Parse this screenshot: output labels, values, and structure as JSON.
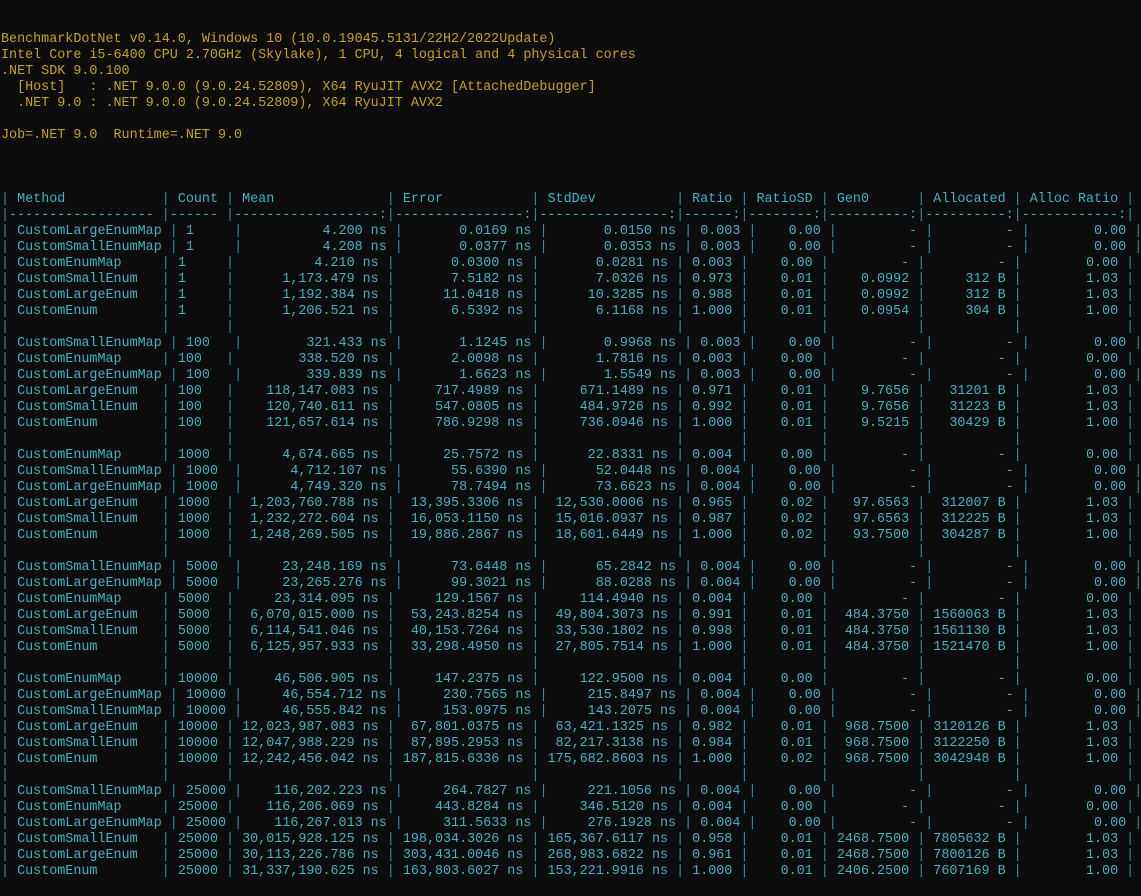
{
  "header_lines": [
    "BenchmarkDotNet v0.14.0, Windows 10 (10.0.19045.5131/22H2/2022Update)",
    "Intel Core i5-6400 CPU 2.70GHz (Skylake), 1 CPU, 4 logical and 4 physical cores",
    ".NET SDK 9.0.100",
    "  [Host]   : .NET 9.0.0 (9.0.24.52809), X64 RyuJIT AVX2 [AttachedDebugger]",
    "  .NET 9.0 : .NET 9.0.0 (9.0.24.52809), X64 RyuJIT AVX2",
    "",
    "Job=.NET 9.0  Runtime=.NET 9.0",
    ""
  ],
  "table": {
    "columns": [
      {
        "name": "Method",
        "width": 19,
        "align": "left"
      },
      {
        "name": "Count",
        "width": 7,
        "align": "left"
      },
      {
        "name": "Mean",
        "width": 19,
        "align": "right"
      },
      {
        "name": "Error",
        "width": 17,
        "align": "right"
      },
      {
        "name": "StdDev",
        "width": 17,
        "align": "right"
      },
      {
        "name": "Ratio",
        "width": 7,
        "align": "right"
      },
      {
        "name": "RatioSD",
        "width": 9,
        "align": "right"
      },
      {
        "name": "Gen0",
        "width": 11,
        "align": "right"
      },
      {
        "name": "Allocated",
        "width": 11,
        "align": "right"
      },
      {
        "name": "Alloc Ratio",
        "width": 13,
        "align": "right"
      }
    ],
    "groups": [
      [
        [
          "CustomLargeEnumMap",
          "1",
          "4.200 ns",
          "0.0169 ns",
          "0.0150 ns",
          "0.003",
          "0.00",
          "-",
          "-",
          "0.00"
        ],
        [
          "CustomSmallEnumMap",
          "1",
          "4.208 ns",
          "0.0377 ns",
          "0.0353 ns",
          "0.003",
          "0.00",
          "-",
          "-",
          "0.00"
        ],
        [
          "CustomEnumMap",
          "1",
          "4.210 ns",
          "0.0300 ns",
          "0.0281 ns",
          "0.003",
          "0.00",
          "-",
          "-",
          "0.00"
        ],
        [
          "CustomSmallEnum",
          "1",
          "1,173.479 ns",
          "7.5182 ns",
          "7.0326 ns",
          "0.973",
          "0.01",
          "0.0992",
          "312 B",
          "1.03"
        ],
        [
          "CustomLargeEnum",
          "1",
          "1,192.384 ns",
          "11.0418 ns",
          "10.3285 ns",
          "0.988",
          "0.01",
          "0.0992",
          "312 B",
          "1.03"
        ],
        [
          "CustomEnum",
          "1",
          "1,206.521 ns",
          "6.5392 ns",
          "6.1168 ns",
          "1.000",
          "0.01",
          "0.0954",
          "304 B",
          "1.00"
        ]
      ],
      [
        [
          "CustomSmallEnumMap",
          "100",
          "321.433 ns",
          "1.1245 ns",
          "0.9968 ns",
          "0.003",
          "0.00",
          "-",
          "-",
          "0.00"
        ],
        [
          "CustomEnumMap",
          "100",
          "338.520 ns",
          "2.0098 ns",
          "1.7816 ns",
          "0.003",
          "0.00",
          "-",
          "-",
          "0.00"
        ],
        [
          "CustomLargeEnumMap",
          "100",
          "339.839 ns",
          "1.6623 ns",
          "1.5549 ns",
          "0.003",
          "0.00",
          "-",
          "-",
          "0.00"
        ],
        [
          "CustomLargeEnum",
          "100",
          "118,147.083 ns",
          "717.4989 ns",
          "671.1489 ns",
          "0.971",
          "0.01",
          "9.7656",
          "31201 B",
          "1.03"
        ],
        [
          "CustomSmallEnum",
          "100",
          "120,740.611 ns",
          "547.0805 ns",
          "484.9726 ns",
          "0.992",
          "0.01",
          "9.7656",
          "31223 B",
          "1.03"
        ],
        [
          "CustomEnum",
          "100",
          "121,657.614 ns",
          "786.9298 ns",
          "736.0946 ns",
          "1.000",
          "0.01",
          "9.5215",
          "30429 B",
          "1.00"
        ]
      ],
      [
        [
          "CustomEnumMap",
          "1000",
          "4,674.665 ns",
          "25.7572 ns",
          "22.8331 ns",
          "0.004",
          "0.00",
          "-",
          "-",
          "0.00"
        ],
        [
          "CustomSmallEnumMap",
          "1000",
          "4,712.107 ns",
          "55.6390 ns",
          "52.0448 ns",
          "0.004",
          "0.00",
          "-",
          "-",
          "0.00"
        ],
        [
          "CustomLargeEnumMap",
          "1000",
          "4,749.320 ns",
          "78.7494 ns",
          "73.6623 ns",
          "0.004",
          "0.00",
          "-",
          "-",
          "0.00"
        ],
        [
          "CustomLargeEnum",
          "1000",
          "1,203,760.788 ns",
          "13,395.3306 ns",
          "12,530.0006 ns",
          "0.965",
          "0.02",
          "97.6563",
          "312007 B",
          "1.03"
        ],
        [
          "CustomSmallEnum",
          "1000",
          "1,232,272.604 ns",
          "16,053.1150 ns",
          "15,016.0937 ns",
          "0.987",
          "0.02",
          "97.6563",
          "312225 B",
          "1.03"
        ],
        [
          "CustomEnum",
          "1000",
          "1,248,269.505 ns",
          "19,886.2867 ns",
          "18,601.6449 ns",
          "1.000",
          "0.02",
          "93.7500",
          "304287 B",
          "1.00"
        ]
      ],
      [
        [
          "CustomSmallEnumMap",
          "5000",
          "23,248.169 ns",
          "73.6448 ns",
          "65.2842 ns",
          "0.004",
          "0.00",
          "-",
          "-",
          "0.00"
        ],
        [
          "CustomLargeEnumMap",
          "5000",
          "23,265.276 ns",
          "99.3021 ns",
          "88.0288 ns",
          "0.004",
          "0.00",
          "-",
          "-",
          "0.00"
        ],
        [
          "CustomEnumMap",
          "5000",
          "23,314.095 ns",
          "129.1567 ns",
          "114.4940 ns",
          "0.004",
          "0.00",
          "-",
          "-",
          "0.00"
        ],
        [
          "CustomLargeEnum",
          "5000",
          "6,070,015.000 ns",
          "53,243.8254 ns",
          "49,804.3073 ns",
          "0.991",
          "0.01",
          "484.3750",
          "1560063 B",
          "1.03"
        ],
        [
          "CustomSmallEnum",
          "5000",
          "6,114,541.046 ns",
          "40,153.7264 ns",
          "33,530.1802 ns",
          "0.998",
          "0.01",
          "484.3750",
          "1561130 B",
          "1.03"
        ],
        [
          "CustomEnum",
          "5000",
          "6,125,957.933 ns",
          "33,298.4950 ns",
          "27,805.7514 ns",
          "1.000",
          "0.01",
          "484.3750",
          "1521470 B",
          "1.00"
        ]
      ],
      [
        [
          "CustomEnumMap",
          "10000",
          "46,506.905 ns",
          "147.2375 ns",
          "122.9500 ns",
          "0.004",
          "0.00",
          "-",
          "-",
          "0.00"
        ],
        [
          "CustomLargeEnumMap",
          "10000",
          "46,554.712 ns",
          "230.7565 ns",
          "215.8497 ns",
          "0.004",
          "0.00",
          "-",
          "-",
          "0.00"
        ],
        [
          "CustomSmallEnumMap",
          "10000",
          "46,555.842 ns",
          "153.0975 ns",
          "143.2075 ns",
          "0.004",
          "0.00",
          "-",
          "-",
          "0.00"
        ],
        [
          "CustomLargeEnum",
          "10000",
          "12,023,987.083 ns",
          "67,801.0375 ns",
          "63,421.1325 ns",
          "0.982",
          "0.01",
          "968.7500",
          "3120126 B",
          "1.03"
        ],
        [
          "CustomSmallEnum",
          "10000",
          "12,047,988.229 ns",
          "87,895.2953 ns",
          "82,217.3138 ns",
          "0.984",
          "0.01",
          "968.7500",
          "3122250 B",
          "1.03"
        ],
        [
          "CustomEnum",
          "10000",
          "12,242,456.042 ns",
          "187,815.6336 ns",
          "175,682.8603 ns",
          "1.000",
          "0.02",
          "968.7500",
          "3042948 B",
          "1.00"
        ]
      ],
      [
        [
          "CustomSmallEnumMap",
          "25000",
          "116,202.223 ns",
          "264.7827 ns",
          "221.1056 ns",
          "0.004",
          "0.00",
          "-",
          "-",
          "0.00"
        ],
        [
          "CustomEnumMap",
          "25000",
          "116,206.069 ns",
          "443.8284 ns",
          "346.5120 ns",
          "0.004",
          "0.00",
          "-",
          "-",
          "0.00"
        ],
        [
          "CustomLargeEnumMap",
          "25000",
          "116,267.013 ns",
          "311.5633 ns",
          "276.1928 ns",
          "0.004",
          "0.00",
          "-",
          "-",
          "0.00"
        ],
        [
          "CustomSmallEnum",
          "25000",
          "30,015,928.125 ns",
          "198,034.3026 ns",
          "165,367.6117 ns",
          "0.958",
          "0.01",
          "2468.7500",
          "7805632 B",
          "1.03"
        ],
        [
          "CustomLargeEnum",
          "25000",
          "30,113,226.786 ns",
          "303,431.0046 ns",
          "268,983.6822 ns",
          "0.961",
          "0.01",
          "2468.7500",
          "7800126 B",
          "1.03"
        ],
        [
          "CustomEnum",
          "25000",
          "31,337,190.625 ns",
          "163,803.6027 ns",
          "153,221.9916 ns",
          "1.000",
          "0.01",
          "2406.2500",
          "7607169 B",
          "1.00"
        ]
      ]
    ]
  },
  "colors": {
    "background": "#0c0c0c",
    "header_text": "#c8a20c",
    "table_text": "#3ab4c6",
    "table_pipe": "#2f8fa8"
  }
}
